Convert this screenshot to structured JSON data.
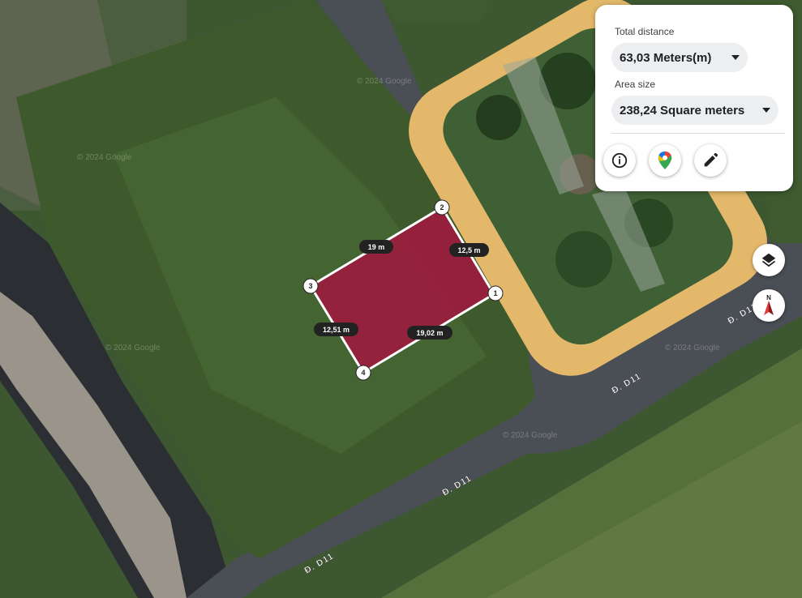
{
  "measurement": {
    "total_distance_label": "Total distance",
    "total_distance_value": "63,03 Meters(m)",
    "area_label": "Area size",
    "area_value": "238,24 Square meters"
  },
  "actions": [
    {
      "name": "info-button",
      "icon": "info-icon"
    },
    {
      "name": "google-maps-button",
      "icon": "google-maps-pin-icon"
    },
    {
      "name": "edit-button",
      "icon": "pencil-icon"
    }
  ],
  "map_controls": [
    {
      "name": "layers-button",
      "icon": "layers-icon"
    },
    {
      "name": "compass-button",
      "icon": "compass-icon",
      "letter": "N"
    }
  ],
  "polygon": {
    "fill_color": "#a3163f",
    "vertices": [
      "1",
      "2",
      "3",
      "4"
    ],
    "edge_labels": [
      "12,5 m",
      "19 m",
      "12,51 m",
      "19,02 m"
    ]
  },
  "road_labels": [
    "Đ. D11",
    "Đ. D11",
    "Đ. D11",
    "Đ. D11"
  ],
  "watermark": "© 2024 Google",
  "colors": {
    "sidewalk": "#e3b86a",
    "road": "#4a4e55",
    "grass": "#3f5a2e"
  }
}
